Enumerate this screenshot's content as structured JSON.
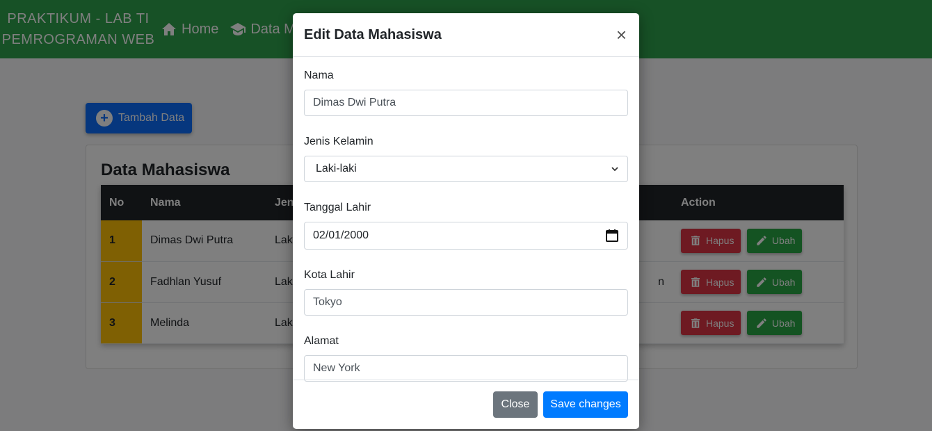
{
  "navbar": {
    "brand_line1": "PRAKTIKUM - LAB TI",
    "brand_line2": "PEMROGRAMAN WEB",
    "links": [
      {
        "label": "Home",
        "icon": "home-icon"
      },
      {
        "label": "Data M",
        "icon": "graduation-cap-icon"
      }
    ]
  },
  "page": {
    "add_button_label": "Tambah Data",
    "card_title": "Data Mahasiswa"
  },
  "table": {
    "headers": {
      "no": "No",
      "nama": "Nama",
      "jenis": "Jen",
      "action": "Action"
    },
    "rows": [
      {
        "no": "1",
        "nama": "Dimas Dwi Putra",
        "jenis": "Laki",
        "extra": ""
      },
      {
        "no": "2",
        "nama": "Fadhlan Yusuf",
        "jenis": "Laki",
        "extra": "n"
      },
      {
        "no": "3",
        "nama": "Melinda",
        "jenis": "Laki",
        "extra": ""
      }
    ],
    "delete_label": "Hapus",
    "edit_label": "Ubah"
  },
  "modal": {
    "title": "Edit Data Mahasiswa",
    "close_glyph": "×",
    "fields": {
      "nama": {
        "label": "Nama",
        "value": "Dimas Dwi Putra"
      },
      "jenis_kelamin": {
        "label": "Jenis Kelamin",
        "value": "Laki-laki"
      },
      "tanggal_lahir": {
        "label": "Tanggal Lahir",
        "value": "02/01/2000"
      },
      "kota_lahir": {
        "label": "Kota Lahir",
        "value": "Tokyo"
      },
      "alamat": {
        "label": "Alamat",
        "value": "New York"
      }
    },
    "close_label": "Close",
    "save_label": "Save changes"
  },
  "colors": {
    "navbar": "#2fa24c",
    "primary": "#0d6efd",
    "danger": "#dc3545",
    "success": "#28a745",
    "warning": "#ffc107",
    "dark": "#212529"
  }
}
